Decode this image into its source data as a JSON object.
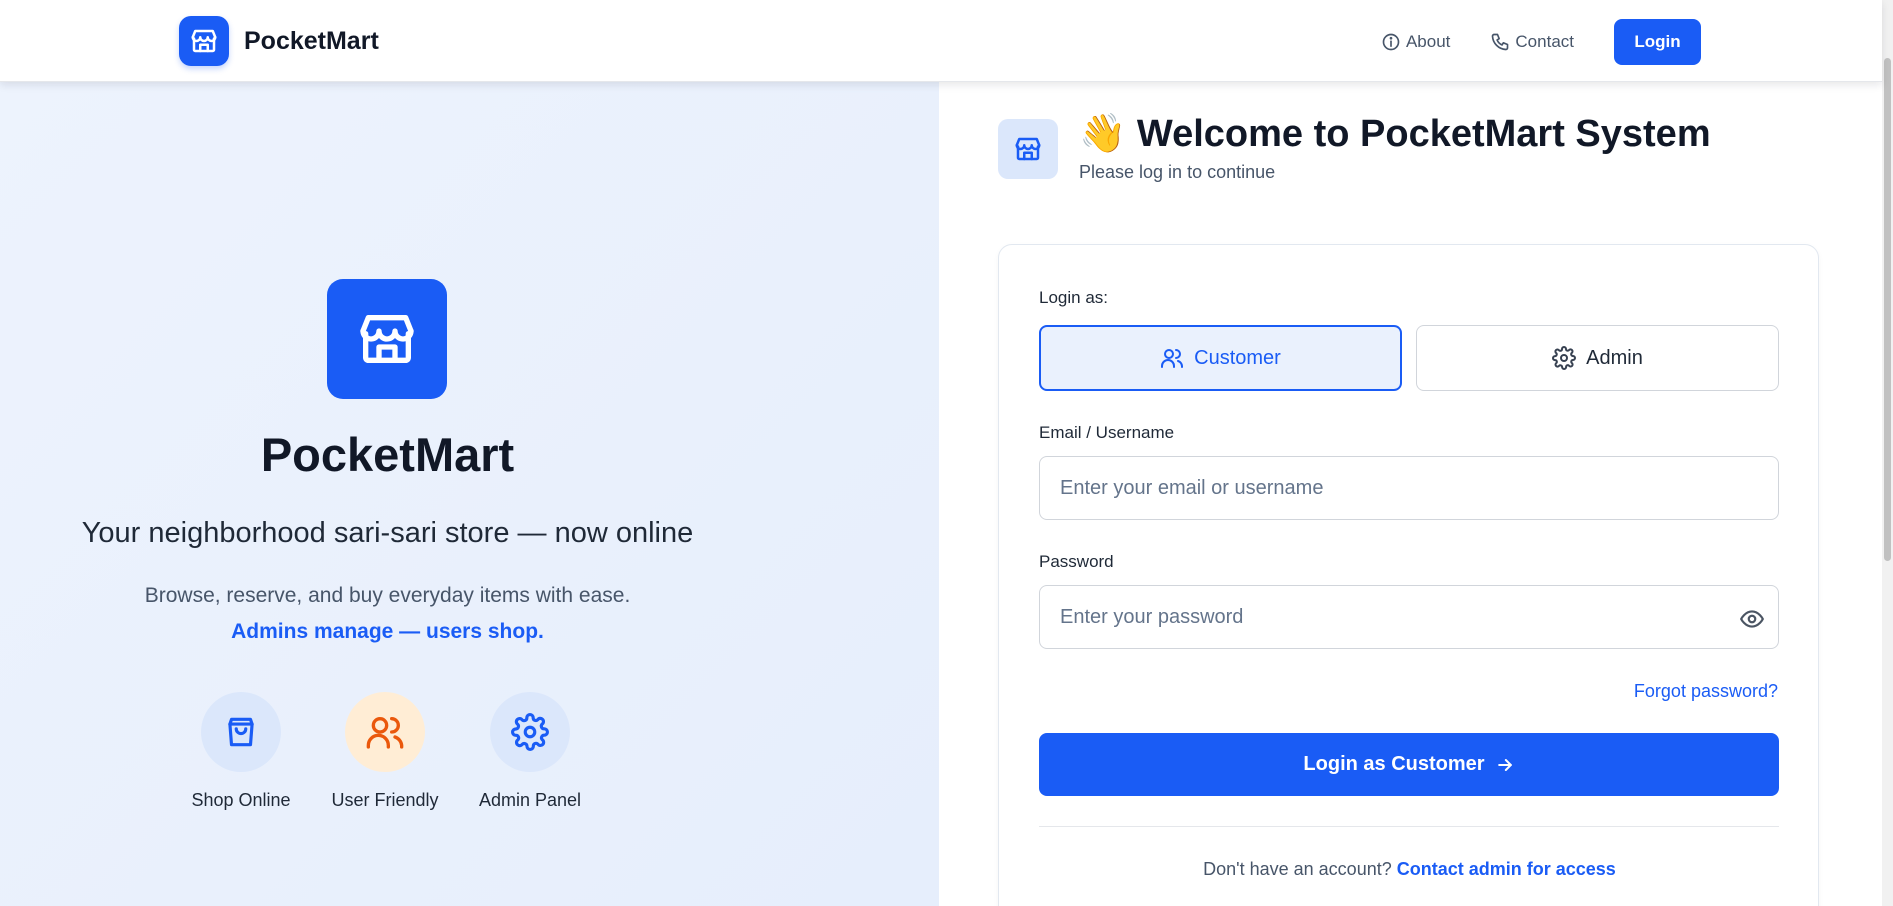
{
  "header": {
    "brand": "PocketMart",
    "nav": {
      "about": "About",
      "contact": "Contact",
      "login": "Login"
    }
  },
  "hero": {
    "title": "PocketMart",
    "tagline": "Your neighborhood sari-sari store — now online",
    "description": "Browse, reserve, and buy everyday items with ease.",
    "accent": "Admins manage — users shop.",
    "features": [
      {
        "label": "Shop Online",
        "icon": "shopping-bag-icon",
        "color": "#1a5cf5",
        "bg": "#dbe7fb"
      },
      {
        "label": "User Friendly",
        "icon": "users-icon",
        "color": "#ea580c",
        "bg": "#ffedd5"
      },
      {
        "label": "Admin Panel",
        "icon": "gear-icon",
        "color": "#1a5cf5",
        "bg": "#dbe7fb"
      }
    ]
  },
  "login": {
    "emoji": "👋",
    "title": "Welcome to PocketMart System",
    "subtitle": "Please log in to continue",
    "role_label": "Login as:",
    "roles": {
      "customer": "Customer",
      "admin": "Admin",
      "selected": "Customer"
    },
    "email_label": "Email / Username",
    "email_placeholder": "Enter your email or username",
    "email_value": "",
    "password_label": "Password",
    "password_placeholder": "Enter your password",
    "password_value": "",
    "forgot": "Forgot password?",
    "submit": "Login as Customer",
    "signup_prompt": "Don't have an account?",
    "signup_link": "Contact admin for access"
  },
  "colors": {
    "primary": "#1a5cf5",
    "accent_orange": "#ea580c"
  }
}
